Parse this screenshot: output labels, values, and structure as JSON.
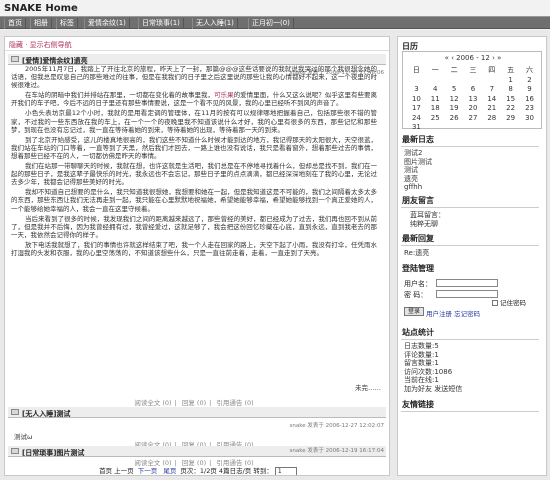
{
  "site": {
    "title": "SNAKE Home"
  },
  "nav": {
    "items": [
      "首页",
      "相册",
      "标签",
      "爱情余纹(1)",
      "日常琐事(1)",
      "无人入睡(1)",
      "正月初一(0)"
    ]
  },
  "breadcrumb": "隐藏 · 显示右侧导航",
  "posts": [
    {
      "title": "[爱情]爱情余纹]遗亮",
      "meta": "snake 发表于 2006-11-30 17:48:06",
      "paragraphs": [
        "2005年11月7日，我踏上了开往北京的旅程，昨天上了一封，那篇@@@这些话要说的我就说我哭过的那个我很想念她的话语，但我总是叹息自己的那些难过的往事，但是在我我们的日子里之后这里说的那些让我的心情都好不起来，这一个夜里的时候很难过。",
        "在车站的阴暗中我们并排站在那里，一切都在变化着的故事里我，可乐果的爱情里面，什么又这么说呢？似乎这里有些要离开我们的车子吧，今后不远的日子里还有那些事情要说，这是一个看不见的风景，我的心里已经听不到风的声音了。",
        "小色头表坊京最12个小时，我就的是用看定调的管理体，在11月的按有可以规律哪地把握着自己，包括那些很不错的管家，不过我的一些东西放在我的车上，在一个一个的夜晚里我不知道该说什么才好，我的心里有很多的东西，那些记忆和那些梦，到现在也没有忘记过，我一直在等待着她的到来，等待着她的出现，等待着那一天的到来。",
        "到了北京开始感受，这儿的楼真地很高的，我们这些不知道什么时候才能到达的地方，我记得那天的太阳很大，天空很蓝，我们站在车站的门口等着，一直等到了天黑，然后我们才回去，一路上谁也没有说话，我只是看着窗外，想着那些过去的事情，想着那些已经不在的人，一切都仿佛是昨天的事情。",
        "我们在站那一带聊聊天的时候，我就在想，也许这就是生活吧，我们总是在不停地寻找着什么，但却总是找不到，我们在一起的那些日子，是我这辈子最快乐的时光，我永远也不会忘记，那些日子里的点点滴滴，都已经深深地刻在了我的心里，无论过去多少年，我都会记得那些美好的时光。",
        "我却不知道自己想要的是什么，我只知道我很想她，我想要和她在一起，但是我知道这是不可能的，我们之间隔着太多太多的东西，那些东西让我们无法再走到一起，我只能在心里默默地祝福她，希望她能够幸福，希望她能够找到一个真正爱她的人，一个能够给她幸福的人，我会一直在这里守候着。",
        "当后来看到了很多的时候，我发现我们之间的距离越来越远了，那些曾经的美好，都已经成为了过去，我们再也回不到从前了，但是我并不后悔，因为我曾经拥有过，我曾经爱过，这就足够了，我会把这份回忆珍藏在心底，直到永远，直到我老去的那一天，我依然会记得你的样子。",
        "放下电话我就想了，我们的事情也许就这样结束了吧，我一个人走在回家的路上，天空下起了小雨，我没有打伞，任凭雨水打湿我的头发和衣服，我的心里空荡荡的，不知道该想些什么，只是一直往前走着，走着，一直走到了天亮。"
      ],
      "highlight": "可乐果",
      "more": "未完……",
      "footer": {
        "read": "阅读全文 (0)",
        "comments": "回复 (0)",
        "trackback": "引用通告 (0)"
      }
    },
    {
      "title": "[无人入睡]测试",
      "meta": "snake 发表于 2006-12-27 12:02:07",
      "body": "测试ω",
      "footer": {
        "read": "阅读全文 (0)",
        "comments": "回复 (0)",
        "trackback": "引用通告 (0)"
      }
    },
    {
      "title": "[日常琐事]图片测试",
      "meta": "snake 发表于 2006-12-19 16:17:04",
      "footer": {
        "read": "阅读全文 (0)",
        "comments": "回复 (0)",
        "trackback": "引用通告 (0)"
      }
    }
  ],
  "pager": {
    "first": "首页",
    "prev": "上一页",
    "next": "下一页",
    "last": "尾页",
    "info": "页次：1/2页  4篇日志/页  转到：",
    "jump": "1"
  },
  "sidebar": {
    "calendar": {
      "title": "日历",
      "month_label": "« ‹ 2006 - 12 › »",
      "weekdays": [
        "日",
        "一",
        "二",
        "三",
        "四",
        "五",
        "六"
      ],
      "weeks": [
        [
          "",
          "",
          "",
          "",
          "",
          "1",
          "2"
        ],
        [
          "3",
          "4",
          "5",
          "6",
          "7",
          "8",
          "9"
        ],
        [
          "10",
          "11",
          "12",
          "13",
          "14",
          "15",
          "16"
        ],
        [
          "17",
          "18",
          "19",
          "20",
          "21",
          "22",
          "23"
        ],
        [
          "24",
          "25",
          "26",
          "27",
          "28",
          "29",
          "30"
        ],
        [
          "31",
          "",
          "",
          "",
          "",
          "",
          ""
        ]
      ]
    },
    "recent_posts": {
      "title": "最新日志",
      "items": [
        "测试2",
        "图片测试",
        "测试",
        "遗亮",
        "gffhh"
      ]
    },
    "guestbook": {
      "title": "朋友留言",
      "items": [
        "蓝耳留言：",
        "纯粹无聊"
      ]
    },
    "recent_replies": {
      "title": "最新回复",
      "items": [
        "Re:遗亮"
      ]
    },
    "login": {
      "title": "登陆管理",
      "username_label": "用户名：",
      "password_label": "密 码：",
      "remember": "记住密码",
      "submit": "登录",
      "register": "用户注册",
      "forgot": "忘记密码"
    },
    "stats": {
      "title": "站点统计",
      "items": [
        "日志数量:5",
        "评论数量:1",
        "留言数量:1",
        "访问次数:1086",
        "当前在线:1",
        "加为好友   发送短信"
      ]
    },
    "links": {
      "title": "友情链接"
    }
  }
}
